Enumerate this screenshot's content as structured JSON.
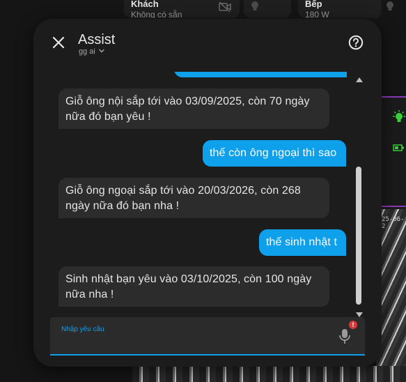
{
  "background": {
    "cards": [
      {
        "title": "Khách",
        "subtitle": "Không có sẵn"
      },
      {
        "title": "Bếp",
        "subtitle": "180 W"
      }
    ],
    "date_fragment": "25-06-2",
    "accent_purple": "#8a3ab9",
    "icons": [
      "camera-off-icon",
      "lightbulb-icon",
      "lightbulb-on-icon",
      "battery-icon"
    ]
  },
  "dialog": {
    "title": "Assist",
    "pipeline": "gg ai",
    "help_icon": "help-circle-icon",
    "close_icon": "close-icon"
  },
  "messages": [
    {
      "from": "user",
      "text": ""
    },
    {
      "from": "bot",
      "text": "Giỗ ông nội sắp tới vào 03/09/2025, còn 70 ngày nữa đó bạn yêu !"
    },
    {
      "from": "user",
      "text": "thế còn ông ngoại thì sao"
    },
    {
      "from": "bot",
      "text": "Giỗ ông ngoại sắp tới vào 20/03/2026, còn 268 ngày nữa đó bạn nha !"
    },
    {
      "from": "user",
      "text": "thế sinh nhật t"
    },
    {
      "from": "bot",
      "text": "Sinh nhật bạn yêu vào 03/10/2025, còn 100 ngày nữa nha !"
    }
  ],
  "input": {
    "label": "Nhập yêu cầu",
    "value": "",
    "mic_icon": "microphone-icon",
    "badge": "!"
  },
  "colors": {
    "accent": "#0ea0ea",
    "dialog_bg": "#1c1c1c",
    "bot_bubble": "#2c2c2c",
    "warning_badge": "#d43a3a"
  }
}
